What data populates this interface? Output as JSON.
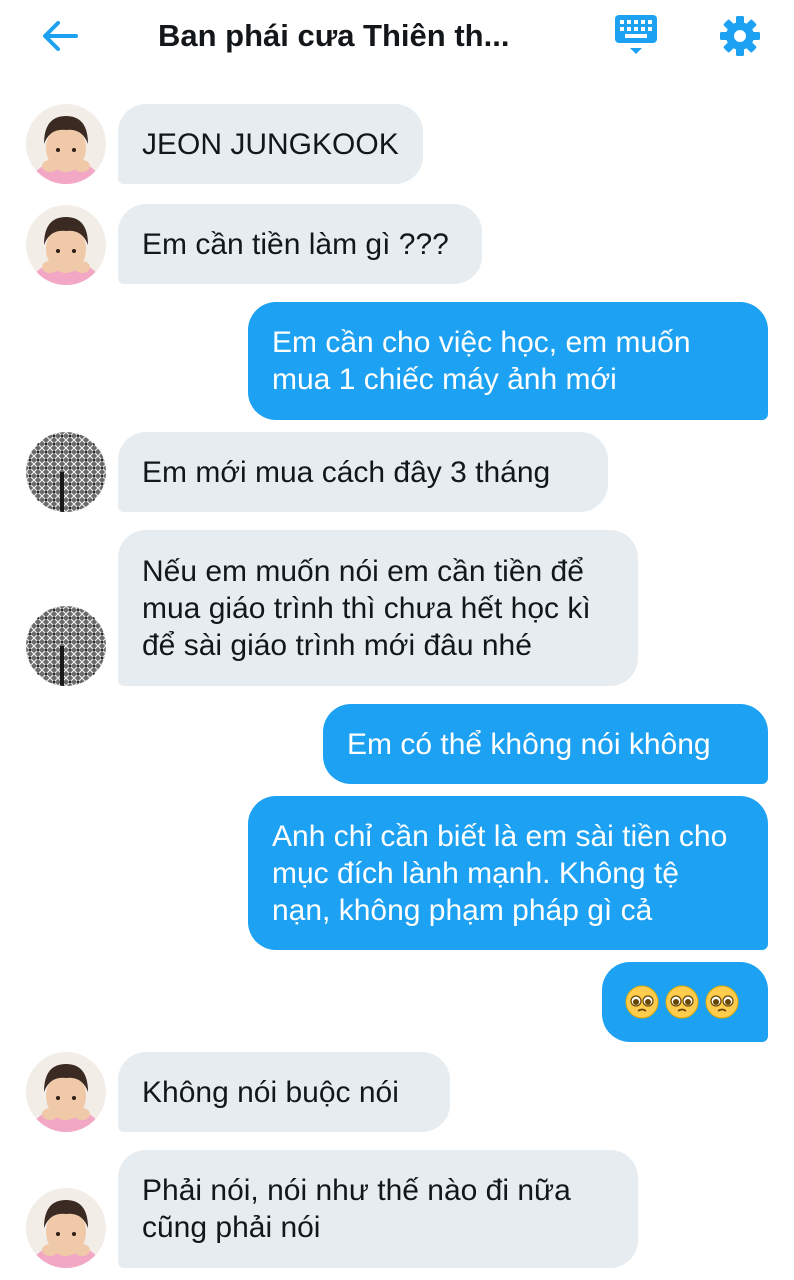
{
  "header": {
    "title": "Ban phái cưa Thiên th...",
    "back_icon": "arrow-left-icon",
    "keyboard_icon": "keyboard-icon",
    "settings_icon": "gear-icon",
    "accent_color": "#1da1f2"
  },
  "colors": {
    "incoming_bubble": "#e6ecf0",
    "outgoing_bubble": "#1da1f2",
    "text_dark": "#14171a"
  },
  "messages": [
    {
      "direction": "incoming",
      "avatar": "portrait-photo",
      "text": "JEON JUNGKOOK"
    },
    {
      "direction": "incoming",
      "avatar": "portrait-photo",
      "text": "Em cần tiền làm gì ???"
    },
    {
      "direction": "outgoing",
      "text": "Em cần cho việc học, em muốn mua 1 chiếc máy ảnh mới"
    },
    {
      "direction": "incoming",
      "avatar": "grayscale-photo",
      "text": "Em mới mua cách đây 3 tháng"
    },
    {
      "direction": "incoming",
      "avatar": "grayscale-photo",
      "text": "Nếu em muốn nói em cần tiền để mua giáo trình thì chưa hết học kì để sài giáo trình mới đâu nhé"
    },
    {
      "direction": "outgoing",
      "text": "Em có thể không nói không"
    },
    {
      "direction": "outgoing",
      "text": "Anh chỉ cần biết là em sài tiền cho mục đích lành mạnh. Không tệ nạn, không phạm pháp gì cả"
    },
    {
      "direction": "outgoing",
      "emoji": [
        "pleading-face-icon",
        "pleading-face-icon",
        "pleading-face-icon"
      ]
    },
    {
      "direction": "incoming",
      "avatar": "portrait-photo",
      "text": "Không nói buộc nói"
    },
    {
      "direction": "incoming",
      "avatar": "portrait-photo",
      "text": "Phải nói, nói như thế nào đi nữa cũng phải nói"
    }
  ]
}
